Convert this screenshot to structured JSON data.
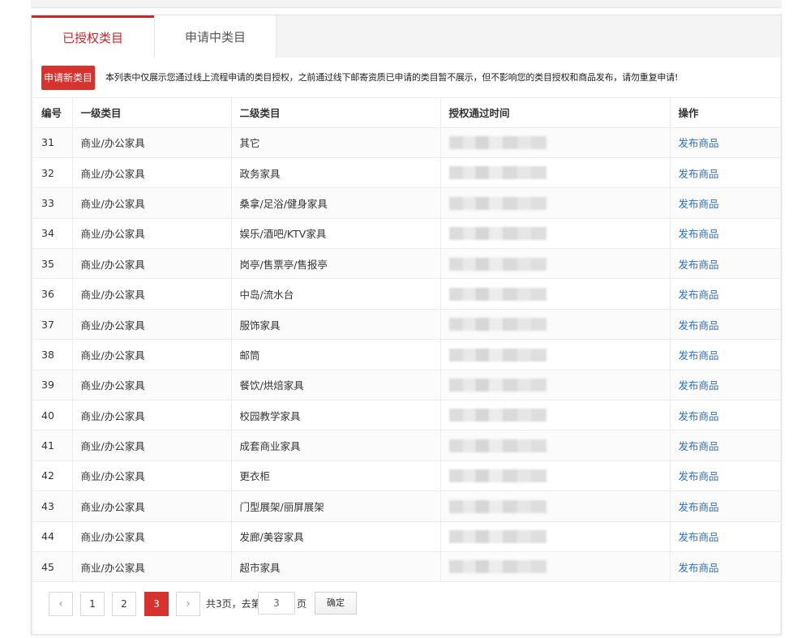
{
  "tabs": [
    {
      "label": "已授权类目"
    },
    {
      "label": "申请中类目"
    }
  ],
  "notice": {
    "apply_button": "申请新类目",
    "text": "本列表中仅展示您通过线上流程申请的类目授权，之前通过线下邮寄资质已申请的类目暂不展示，但不影响您的类目授权和商品发布，请勿重复申请!"
  },
  "table": {
    "headers": [
      "编号",
      "一级类目",
      "二级类目",
      "授权通过时间",
      "操作"
    ],
    "rows": [
      {
        "id": "31",
        "level1": "商业/办公家具",
        "level2": "其它",
        "action": "发布商品"
      },
      {
        "id": "32",
        "level1": "商业/办公家具",
        "level2": "政务家具",
        "action": "发布商品"
      },
      {
        "id": "33",
        "level1": "商业/办公家具",
        "level2": "桑拿/足浴/健身家具",
        "action": "发布商品"
      },
      {
        "id": "34",
        "level1": "商业/办公家具",
        "level2": "娱乐/酒吧/KTV家具",
        "action": "发布商品"
      },
      {
        "id": "35",
        "level1": "商业/办公家具",
        "level2": "岗亭/售票亭/售报亭",
        "action": "发布商品"
      },
      {
        "id": "36",
        "level1": "商业/办公家具",
        "level2": "中岛/流水台",
        "action": "发布商品"
      },
      {
        "id": "37",
        "level1": "商业/办公家具",
        "level2": "服饰家具",
        "action": "发布商品"
      },
      {
        "id": "38",
        "level1": "商业/办公家具",
        "level2": "邮筒",
        "action": "发布商品"
      },
      {
        "id": "39",
        "level1": "商业/办公家具",
        "level2": "餐饮/烘焙家具",
        "action": "发布商品"
      },
      {
        "id": "40",
        "level1": "商业/办公家具",
        "level2": "校园教学家具",
        "action": "发布商品"
      },
      {
        "id": "41",
        "level1": "商业/办公家具",
        "level2": "成套商业家具",
        "action": "发布商品"
      },
      {
        "id": "42",
        "level1": "商业/办公家具",
        "level2": "更衣柜",
        "action": "发布商品"
      },
      {
        "id": "43",
        "level1": "商业/办公家具",
        "level2": "门型展架/丽屏展架",
        "action": "发布商品"
      },
      {
        "id": "44",
        "level1": "商业/办公家具",
        "level2": "发廊/美容家具",
        "action": "发布商品"
      },
      {
        "id": "45",
        "level1": "商业/办公家具",
        "level2": "超市家具",
        "action": "发布商品"
      }
    ]
  },
  "pagination": {
    "prev_icon": "chevron-left-icon",
    "next_icon": "chevron-right-icon",
    "pages": [
      "1",
      "2",
      "3"
    ],
    "current": "3",
    "total_text": "共3页，去第",
    "input_value": "3",
    "page_suffix": "页",
    "confirm_label": "确定"
  },
  "colors": {
    "accent": "#d8322f",
    "link": "#2a70c2"
  }
}
